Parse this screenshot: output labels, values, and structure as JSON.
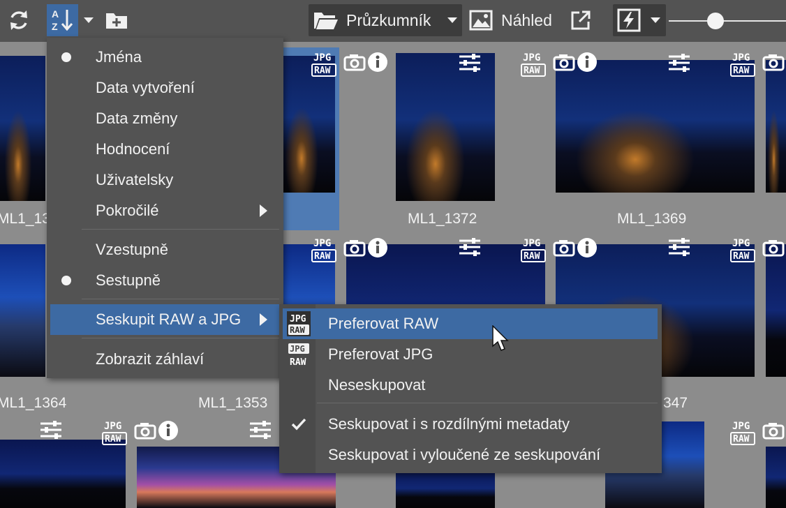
{
  "toolbar": {
    "explorer_label": "Průzkumník",
    "preview_label": "Náhled",
    "icons": [
      "refresh-icon",
      "sort-az-icon",
      "dropdown-arrow-icon",
      "new-folder-icon",
      "folder-open-icon",
      "image-icon",
      "external-link-icon",
      "flash-icon",
      "zoom-slider"
    ]
  },
  "grid": {
    "thumbnails": [
      {
        "name": "ML1_13",
        "badge_top": "JPG",
        "badge_bottom": "RAW"
      },
      {
        "name": "ML1_1372",
        "badge_top": "JPG",
        "badge_bottom": "RAW"
      },
      {
        "name": "ML1_1369",
        "badge_top": "JPG",
        "badge_bottom": "RAW"
      },
      {
        "name": "ML1_1364",
        "badge_top": "JPG",
        "badge_bottom": "RAW"
      },
      {
        "name": "ML1_1353",
        "badge_top": "JPG",
        "badge_bottom": "RAW"
      },
      {
        "name": "347",
        "badge_top": "JPG",
        "badge_bottom": "RAW"
      }
    ]
  },
  "sort_menu": {
    "items": [
      {
        "label": "Jména",
        "selected": true
      },
      {
        "label": "Data vytvoření"
      },
      {
        "label": "Data změny"
      },
      {
        "label": "Hodnocení"
      },
      {
        "label": "Uživatelsky"
      },
      {
        "label": "Pokročilé",
        "submenu": true
      },
      {
        "label": "Vzestupně"
      },
      {
        "label": "Sestupně",
        "selected": true
      },
      {
        "label": "Seskupit RAW a JPG",
        "submenu": true,
        "highlighted": true
      },
      {
        "label": "Zobrazit záhlaví"
      }
    ]
  },
  "group_submenu": {
    "items": [
      {
        "label": "Preferovat RAW",
        "highlighted": true,
        "icon": "jpg-raw-icon"
      },
      {
        "label": "Preferovat JPG",
        "icon": "jpg-raw-icon"
      },
      {
        "label": "Neseskupovat"
      },
      {
        "label": "Seskupovat i s rozdílnými metadaty",
        "checked": true
      },
      {
        "label": "Seskupovat i vyloučené ze seskupování"
      }
    ]
  },
  "colors": {
    "toolbar": "#535353",
    "accent": "#3d6aa3",
    "background": "#8c8c8c",
    "menu": "#535353"
  }
}
